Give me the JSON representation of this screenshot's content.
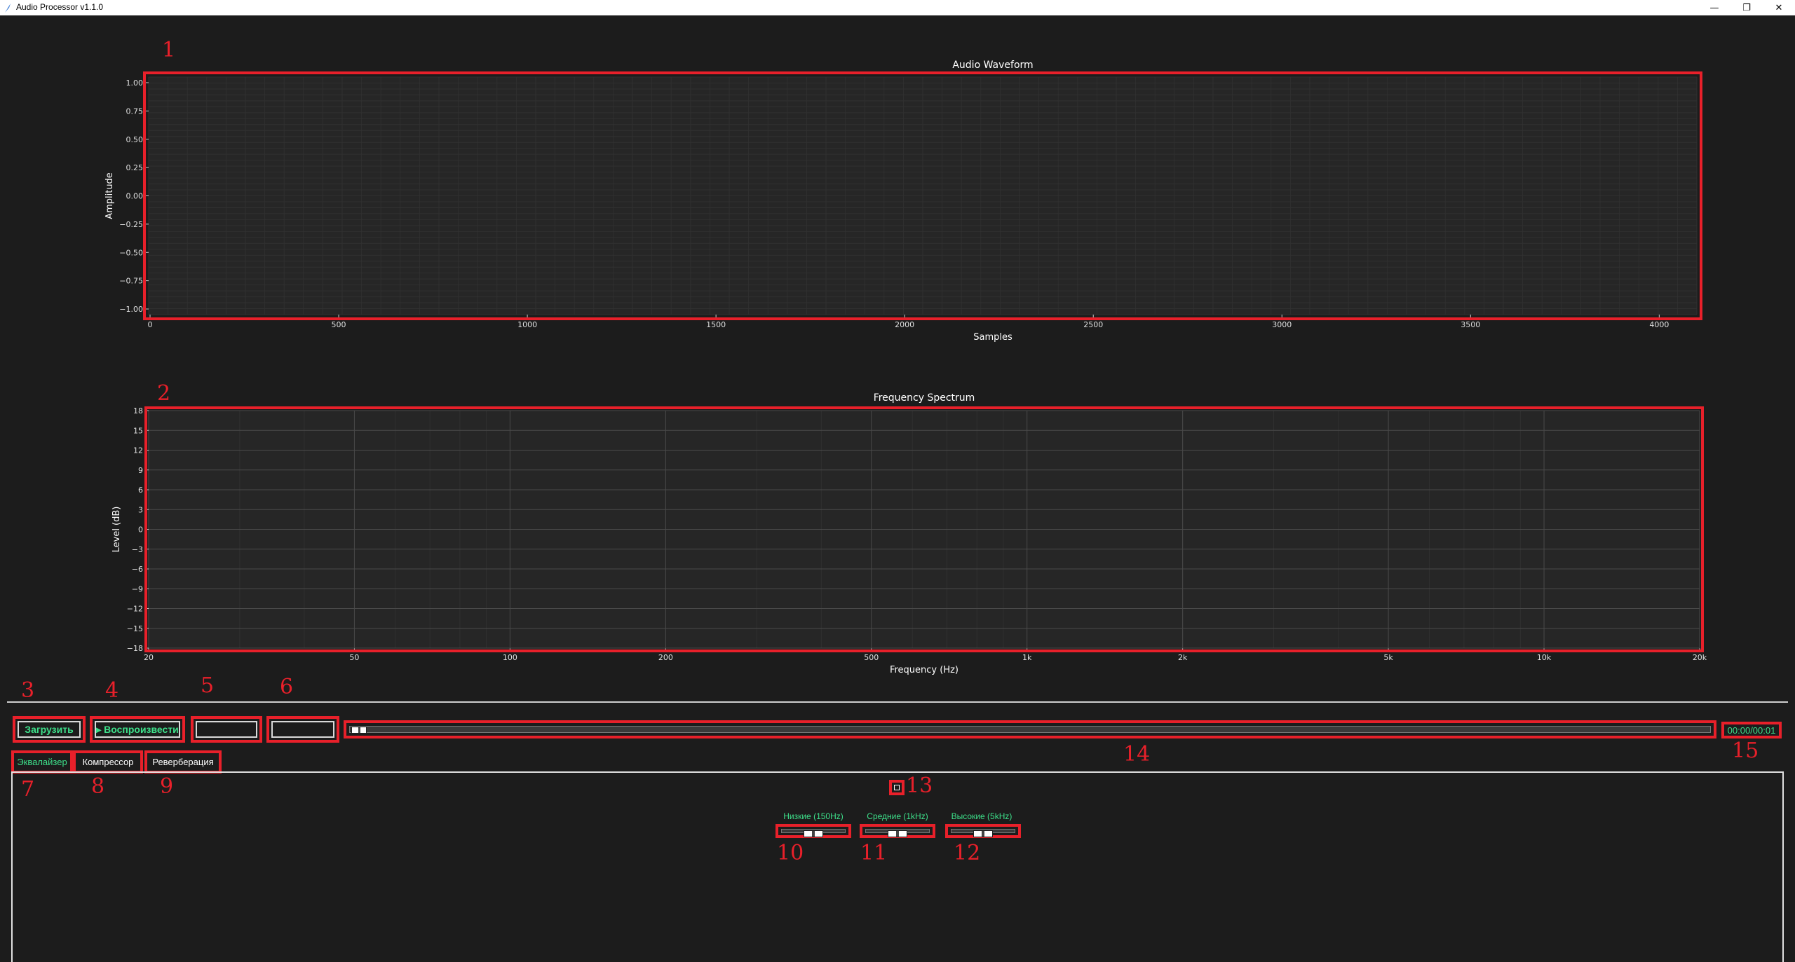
{
  "window": {
    "title": "Audio Processor v1.1.0",
    "minimize_glyph": "—",
    "restore_glyph": "❐",
    "close_glyph": "✕"
  },
  "annotations": [
    "1",
    "2",
    "3",
    "4",
    "5",
    "6",
    "7",
    "8",
    "9",
    "10",
    "11",
    "12",
    "13",
    "14",
    "15"
  ],
  "chart_data": [
    {
      "type": "line",
      "title": "Audio Waveform",
      "xlabel": "Samples",
      "ylabel": "Amplitude",
      "xlim": [
        0,
        4096
      ],
      "ylim": [
        -1.0,
        1.0
      ],
      "x_ticks": [
        0,
        500,
        1000,
        1500,
        2000,
        2500,
        3000,
        3500,
        4000
      ],
      "y_ticks": [
        "1.00",
        "0.75",
        "0.50",
        "0.25",
        "0.00",
        "−0.25",
        "−0.50",
        "−0.75",
        "−1.00"
      ],
      "grid": true,
      "series": []
    },
    {
      "type": "line",
      "title": "Frequency Spectrum",
      "xlabel": "Frequency (Hz)",
      "ylabel": "Level (dB)",
      "xscale": "log",
      "xlim": [
        20,
        20000
      ],
      "ylim": [
        -18,
        18
      ],
      "x_ticks": [
        20,
        50,
        100,
        200,
        500,
        1000,
        2000,
        5000,
        10000,
        20000
      ],
      "x_tick_labels": [
        "20",
        "50",
        "100",
        "200",
        "500",
        "1k",
        "2k",
        "5k",
        "10k",
        "20k"
      ],
      "y_ticks": [
        "18",
        "15",
        "12",
        "9",
        "6",
        "3",
        "0",
        "−3",
        "−6",
        "−9",
        "−12",
        "−15",
        "−18"
      ],
      "grid": true,
      "series": []
    }
  ],
  "controls": {
    "load_label": "Загрузить",
    "play_label": "▸ Воспроизвести",
    "button5_label": "",
    "button6_label": "",
    "progress": 0.0,
    "time": "00:00/00:01"
  },
  "tabs": [
    {
      "label": "Эквалайзер",
      "active": true
    },
    {
      "label": "Компрессор",
      "active": false
    },
    {
      "label": "Реверберация",
      "active": false
    }
  ],
  "equalizer": {
    "bands": [
      {
        "label": "Низкие (150Hz)",
        "value": 0.5
      },
      {
        "label": "Средние (1kHz)",
        "value": 0.5
      },
      {
        "label": "Высокие (5kHz)",
        "value": 0.5
      }
    ]
  },
  "colors": {
    "background": "#1c1c1c",
    "accent_green": "#3de08a",
    "annotation_red": "#e8202a"
  }
}
